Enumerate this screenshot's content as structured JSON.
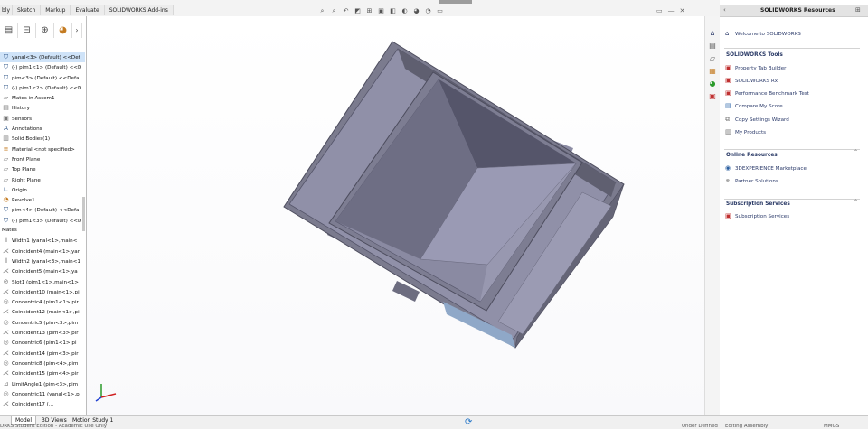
{
  "toolbar": {
    "tabs": [
      "bly",
      "Sketch",
      "Markup",
      "Evaluate",
      "SOLIDWORKS Add-ins"
    ]
  },
  "feature_manager": {
    "items": [
      {
        "label": "yanal<3> (Default) <<Def",
        "icon": "component-icon",
        "selected": true
      },
      {
        "label": "(-) pim1<1> (Default) <<D",
        "icon": "component-icon"
      },
      {
        "label": "pim<3> (Default) <<Defa",
        "icon": "component-icon"
      },
      {
        "label": "(-) pim1<2> (Default) <<D",
        "icon": "component-icon"
      },
      {
        "label": "Mates in Assem1",
        "icon": "mates-folder-icon"
      },
      {
        "label": "History",
        "icon": "history-icon"
      },
      {
        "label": "Sensors",
        "icon": "sensors-icon"
      },
      {
        "label": "Annotations",
        "icon": "annotations-icon"
      },
      {
        "label": "Solid Bodies(1)",
        "icon": "solid-bodies-icon"
      },
      {
        "label": "Material <not specified>",
        "icon": "material-icon"
      },
      {
        "label": "Front Plane",
        "icon": "plane-icon"
      },
      {
        "label": "Top Plane",
        "icon": "plane-icon"
      },
      {
        "label": "Right Plane",
        "icon": "plane-icon"
      },
      {
        "label": "Origin",
        "icon": "origin-icon"
      },
      {
        "label": "Revolve1",
        "icon": "revolve-icon"
      },
      {
        "label": "pim<4> (Default) <<Defa",
        "icon": "component-icon"
      },
      {
        "label": "(-) pim1<3> (Default) <<D",
        "icon": "component-icon"
      }
    ],
    "mates_heading": "Mates",
    "mates": [
      {
        "label": "Width1 (yanal<1>,main<",
        "icon": "width-mate-icon"
      },
      {
        "label": "Coincident4 (main<1>,yar",
        "icon": "coincident-mate-icon"
      },
      {
        "label": "Width2 (yanal<3>,main<1",
        "icon": "width-mate-icon"
      },
      {
        "label": "Coincident5 (main<1>,ya",
        "icon": "coincident-mate-icon"
      },
      {
        "label": "Slot1 (pim1<1>,main<1>",
        "icon": "slot-mate-icon"
      },
      {
        "label": "Coincident10 (main<1>,pi",
        "icon": "coincident-mate-icon"
      },
      {
        "label": "Concentric4 (pim1<1>,pir",
        "icon": "concentric-mate-icon"
      },
      {
        "label": "Coincident12 (main<1>,pi",
        "icon": "coincident-mate-icon"
      },
      {
        "label": "Concentric5 (pim<3>,pim",
        "icon": "concentric-mate-icon"
      },
      {
        "label": "Coincident13 (pim<3>,pir",
        "icon": "coincident-mate-icon"
      },
      {
        "label": "Concentric6 (pim1<1>,pi",
        "icon": "concentric-mate-icon"
      },
      {
        "label": "Coincident14 (pim<3>,pir",
        "icon": "coincident-mate-icon"
      },
      {
        "label": "Concentric8 (pim<4>,pim",
        "icon": "concentric-mate-icon"
      },
      {
        "label": "Coincident15 (pim<4>,pir",
        "icon": "coincident-mate-icon"
      },
      {
        "label": "LimitAngle1 (pim<3>,pim",
        "icon": "limit-angle-mate-icon"
      },
      {
        "label": "Concentric11 (yanal<1>,p",
        "icon": "concentric-mate-icon"
      },
      {
        "label": "Coincident17 (...",
        "icon": "coincident-mate-icon"
      }
    ]
  },
  "bottom": {
    "tabs": [
      "Model",
      "3D Views",
      "Motion Study 1"
    ],
    "status_left": "DRKS Student Edition - Academic Use Only",
    "status_mid": "Under Defined",
    "status_edit": "Editing Assembly",
    "status_units": "MMGS"
  },
  "task_pane": {
    "title": "SOLIDWORKS Resources",
    "welcome": "Welcome to SOLIDWORKS",
    "sections": [
      {
        "title": "SOLIDWORKS Tools",
        "items": [
          {
            "label": "Property Tab Builder",
            "icon": "property-tab-builder-icon"
          },
          {
            "label": "SOLIDWORKS Rx",
            "icon": "solidworks-rx-icon"
          },
          {
            "label": "Performance Benchmark Test",
            "icon": "benchmark-icon"
          },
          {
            "label": "Compare My Score",
            "icon": "compare-score-icon"
          },
          {
            "label": "Copy Settings Wizard",
            "icon": "copy-settings-icon"
          },
          {
            "label": "My Products",
            "icon": "my-products-icon"
          }
        ]
      },
      {
        "title": "Online Resources",
        "items": [
          {
            "label": "3DEXPERIENCE Marketplace",
            "icon": "marketplace-icon"
          },
          {
            "label": "Partner Solutions",
            "icon": "partner-solutions-icon"
          }
        ]
      },
      {
        "title": "Subscription Services",
        "items": [
          {
            "label": "Subscription Services",
            "icon": "subscription-icon"
          }
        ]
      }
    ]
  },
  "colors": {
    "model_fill": "#7b7b8e",
    "model_dark": "#5e5e6f",
    "model_light": "#9797b2",
    "selection_blue": "#cfe3f8",
    "link_blue": "#2b3a6a"
  }
}
